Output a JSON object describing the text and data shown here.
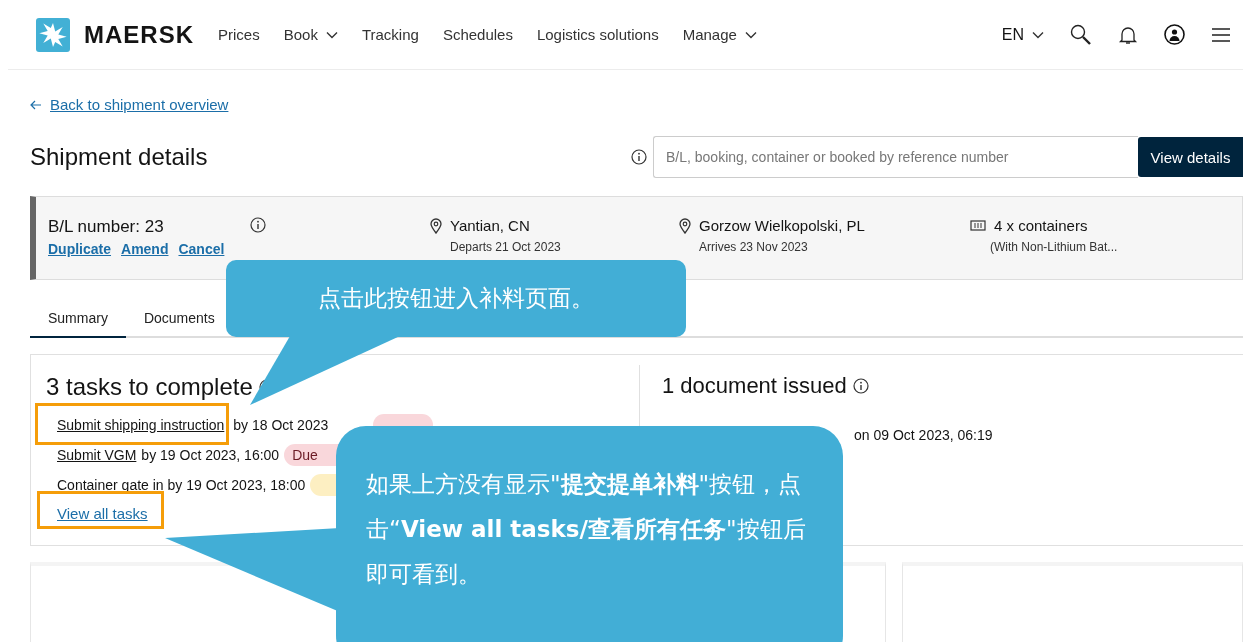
{
  "nav": {
    "logo": "MAERSK",
    "items": [
      {
        "label": "Prices",
        "dropdown": false
      },
      {
        "label": "Book",
        "dropdown": true
      },
      {
        "label": "Tracking",
        "dropdown": false
      },
      {
        "label": "Schedules",
        "dropdown": false
      },
      {
        "label": "Logistics solutions",
        "dropdown": false
      },
      {
        "label": "Manage",
        "dropdown": true
      }
    ],
    "language": "EN"
  },
  "back_link": "Back to shipment overview",
  "page_title": "Shipment details",
  "search": {
    "placeholder": "B/L, booking, container or booked by reference number",
    "button": "View details"
  },
  "shipment": {
    "bl_number": "B/L number: 23",
    "actions": [
      "Duplicate",
      "Amend",
      "Cancel"
    ],
    "origin": {
      "place": "Yantian, CN",
      "date": "Departs 21 Oct 2023"
    },
    "destination": {
      "place": "Gorzow Wielkopolski, PL",
      "date": "Arrives 23 Nov 2023"
    },
    "cargo": {
      "count": "4 x containers",
      "detail": "(With Non-Lithium Bat..."
    }
  },
  "tabs": [
    {
      "label": "Summary",
      "selected": true
    },
    {
      "label": "Documents",
      "selected": false
    }
  ],
  "tasks": {
    "title": "3 tasks to complete",
    "items": [
      {
        "kind": "link",
        "link": "Submit shipping instruction",
        "text": "by 18 Oct 2023",
        "highlighted": true,
        "badge": {
          "color": "#f9d7db"
        }
      },
      {
        "kind": "link",
        "link": "Submit VGM",
        "text": "by 19 Oct 2023, 16:00",
        "highlighted": false,
        "badge": {
          "text": "Due",
          "color": "#f9d7db"
        }
      },
      {
        "kind": "plain",
        "text": "Container gate in by 19 Oct 2023, 18:00",
        "highlighted": false,
        "badge": {
          "color": "#fdefc2"
        }
      }
    ],
    "view_all": {
      "label": "View all tasks",
      "highlighted": true
    }
  },
  "documents": {
    "title": "1 document issued",
    "items": [
      {
        "text": "on 09 Oct 2023, 06:19"
      }
    ]
  },
  "callouts": [
    {
      "text": "点击此按钮进入补料页面。"
    },
    {
      "text": "如果上方没有显示\"**提交提单补料**\"按钮，点击“**View all tasks/查看所有任务**\"按钮后即可看到。"
    }
  ]
}
